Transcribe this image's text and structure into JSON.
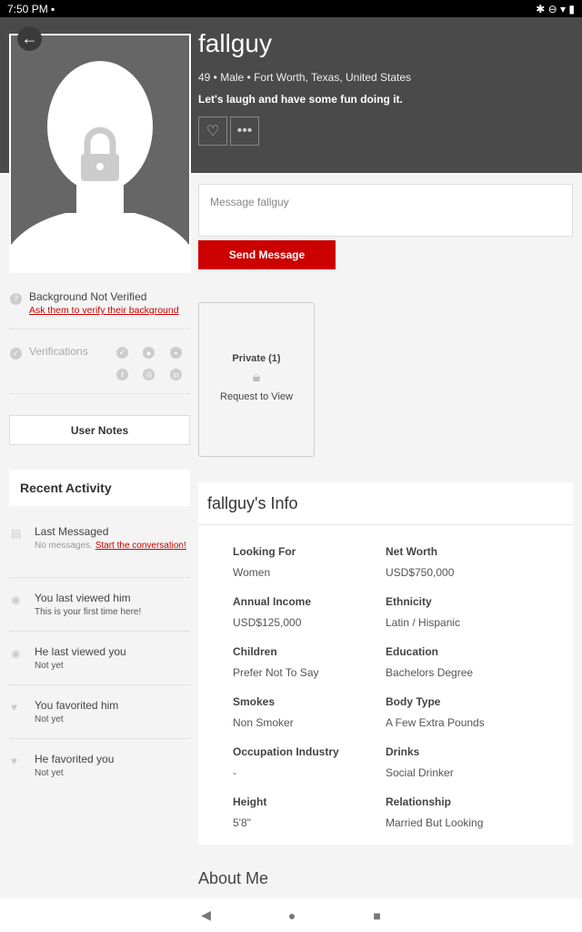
{
  "status": {
    "time": "7:50 PM",
    "icons": [
      "image-icon",
      "bluetooth-icon",
      "dnd-icon",
      "wifi-icon",
      "battery-icon"
    ]
  },
  "profile": {
    "name": "fallguy",
    "meta": "49 • Male • Fort Worth, Texas, United States",
    "tagline": "Let's laugh and have some fun doing it."
  },
  "message": {
    "placeholder": "Message fallguy",
    "send": "Send Message"
  },
  "private": {
    "label": "Private (1)",
    "action": "Request to View"
  },
  "background": {
    "label": "Background Not Verified",
    "link": "Ask them to verify their background"
  },
  "verifications": {
    "label": "Verifications",
    "icons": [
      "check-icon",
      "user-icon",
      "photo-icon",
      "facebook-icon",
      "instagram-icon",
      "linkedin-icon"
    ]
  },
  "user_notes": "User Notes",
  "recent": {
    "title": "Recent Activity",
    "items": [
      {
        "title": "Last Messaged",
        "sub": "No messages.",
        "link": "Start the conversation!"
      },
      {
        "title": "You last viewed him",
        "sub": "This is your first time here!"
      },
      {
        "title": "He last viewed you",
        "sub": "Not yet"
      },
      {
        "title": "You favorited him",
        "sub": "Not yet"
      },
      {
        "title": "He favorited you",
        "sub": "Not yet"
      }
    ]
  },
  "info": {
    "title": "fallguy's Info",
    "fields": [
      {
        "label": "Looking For",
        "value": "Women"
      },
      {
        "label": "Net Worth",
        "value": "USD$750,000"
      },
      {
        "label": "Annual Income",
        "value": "USD$125,000"
      },
      {
        "label": "Ethnicity",
        "value": "Latin / Hispanic"
      },
      {
        "label": "Children",
        "value": "Prefer Not To Say"
      },
      {
        "label": "Education",
        "value": "Bachelors Degree"
      },
      {
        "label": "Smokes",
        "value": "Non Smoker"
      },
      {
        "label": "Body Type",
        "value": "A Few Extra Pounds"
      },
      {
        "label": "Occupation Industry",
        "value": "-"
      },
      {
        "label": "Drinks",
        "value": "Social Drinker"
      },
      {
        "label": "Height",
        "value": "5'8\""
      },
      {
        "label": "Relationship",
        "value": "Married But Looking"
      }
    ]
  },
  "about": {
    "title": "About Me"
  },
  "colors": {
    "accent": "#cc0000",
    "header": "#4a4a4a"
  }
}
